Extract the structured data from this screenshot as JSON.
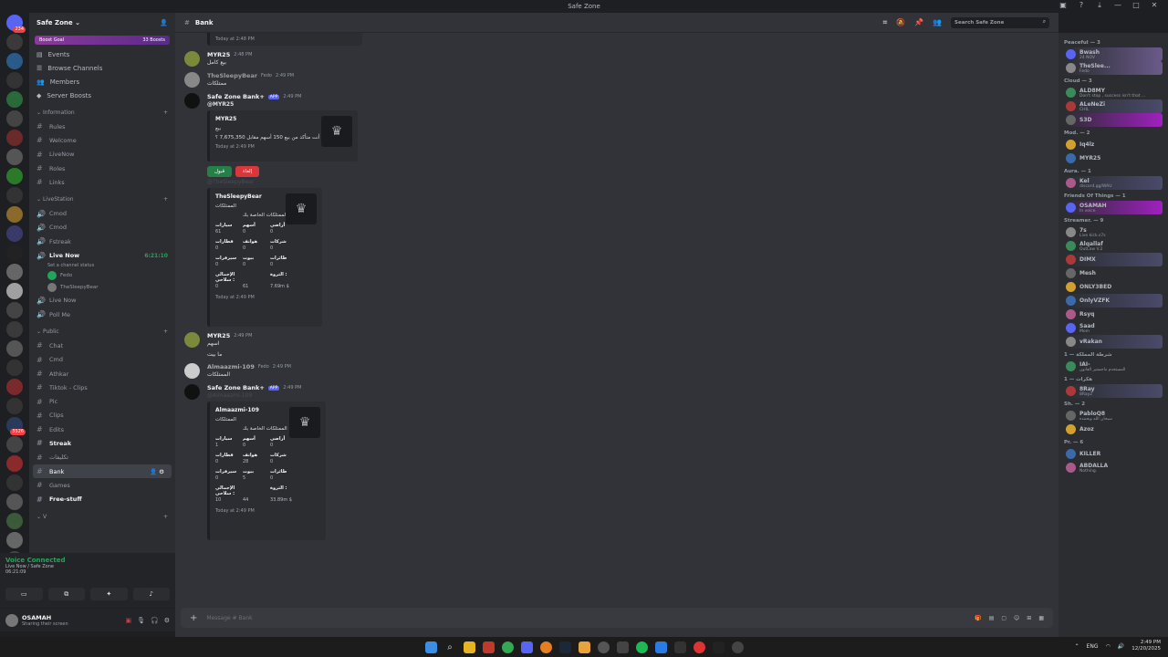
{
  "window": {
    "title": "Safe Zone"
  },
  "servers": {
    "badges": [
      "234",
      "",
      "",
      "",
      "",
      "",
      "",
      "",
      "",
      "",
      "",
      "",
      "",
      "",
      "",
      "",
      "",
      "",
      "",
      "",
      "",
      "3526",
      "",
      "",
      "",
      "",
      "",
      "",
      "",
      ""
    ]
  },
  "guild": {
    "name": "Safe Zone",
    "boost_label": "Boost Goal",
    "boost_count": "33 Boosts",
    "nav": [
      "Events",
      "Browse Channels",
      "Members",
      "Server Boosts"
    ],
    "categories": {
      "information": "Information",
      "livestation": "LiveStation",
      "public": "Public",
      "last": "V"
    },
    "info_channels": [
      "Rules",
      "Welcome",
      "LiveNow",
      "Roles",
      "Links"
    ],
    "live_channels": [
      "Cmod",
      "Cmod",
      "Fstreak"
    ],
    "live_now": {
      "name": "Live Now",
      "time": "6:21:10",
      "status": "Set a channel status"
    },
    "vc_users": [
      "Fedo",
      "TheSleepyBear"
    ],
    "more_live": [
      "Live Now",
      "Poll Me"
    ],
    "public_channels": [
      "Chat",
      "Cmd",
      "Athkar",
      "Tiktok - Clips",
      "Pic",
      "Clips",
      "Edits",
      "Streak",
      "تكليفات",
      "Bank",
      "Games",
      "Free-stuff"
    ]
  },
  "voice": {
    "title": "Voice Connected",
    "sub": "Live Now / Safe Zone",
    "time": "06:21:09"
  },
  "user": {
    "name": "OSAMAH",
    "status": "Sharing their screen"
  },
  "channel": {
    "name": "Bank",
    "search_placeholder": "Search Safe Zone",
    "composer_placeholder": "Message # Bank"
  },
  "messages": {
    "m0_time": "Today at 2:48 PM",
    "m1": {
      "author": "MYR25",
      "time": "2:48 PM",
      "text": "بيع كامل"
    },
    "m2": {
      "author": "TheSleepyBear",
      "tag": "Fedo",
      "time": "2:49 PM",
      "text": "ممتلكات"
    },
    "m3": {
      "author": "Safe Zone Bank+",
      "app": "APP",
      "time": "2:49 PM",
      "mention": "@MYR25",
      "embed_author": "MYR25",
      "embed_title": "بيع",
      "embed_text": "هل أنت متأكد من بيع 150 أسهم مقابل 7,675,350 ؟",
      "embed_time": "Today at 2:49 PM",
      "btn_accept": "قبول",
      "btn_cancel": "إلغاء"
    },
    "m4": {
      "mention": "@TheSleepyBear",
      "embed_author": "TheSleepyBear",
      "embed_title": "الممتلكات",
      "embed_sub": "الممتلكات الخاصة بك",
      "grid": [
        [
          "سيارات",
          "أسهم",
          "أراضي"
        ],
        [
          "61",
          "0",
          "0"
        ],
        [
          "قطارات",
          "هواتف",
          "شركات"
        ],
        [
          "0",
          "0",
          "0"
        ],
        [
          "سيرفرات",
          "بيوت",
          "طائرات"
        ],
        [
          "0",
          "0",
          "0"
        ],
        [
          "الإجمالي : سلاحي",
          "",
          "الثروة :"
        ],
        [
          "0",
          "61",
          "7.69m $"
        ]
      ],
      "embed_time": "Today at 2:49 PM"
    },
    "m5": {
      "author": "MYR25",
      "time": "2:49 PM",
      "text1": "اسهم",
      "text2": "ما بيت"
    },
    "m6": {
      "author": "Almaazmi-109",
      "tag": "Fedo",
      "time": "2:49 PM",
      "text": "الممتلكات"
    },
    "m7": {
      "author": "Safe Zone Bank+",
      "app": "APP",
      "time": "2:49 PM",
      "mention": "@Almaazmi-109",
      "embed_author": "Almaazmi-109",
      "embed_title": "الممتلكات",
      "embed_sub": "الممتلكات الخاصة بك",
      "grid": [
        [
          "سيارات",
          "أسهم",
          "أراضي"
        ],
        [
          "1",
          "0",
          "0"
        ],
        [
          "قطارات",
          "هواتف",
          "شركات"
        ],
        [
          "0",
          "28",
          "0"
        ],
        [
          "سيرفرات",
          "بيوت",
          "طائرات"
        ],
        [
          "0",
          "5",
          "0"
        ],
        [
          "الإجمالي : سلاحي",
          "",
          "الثروة :"
        ],
        [
          "10",
          "44",
          "33.89m $"
        ]
      ],
      "embed_time": "Today at 2:49 PM"
    }
  },
  "members": {
    "cat_peaceful": "Peaceful — 3",
    "peaceful": [
      {
        "name": "Bwash",
        "sub": "24 NOV"
      },
      {
        "name": "TheSlee...",
        "sub": "Fedo"
      }
    ],
    "cat_cloud": "Cloud — 3",
    "cloud": [
      {
        "name": "ALD8MY",
        "sub": "Don't stop , success isn't that ..."
      },
      {
        "name": "ALeNeZi",
        "sub": "CHIL"
      },
      {
        "name": "S3D",
        "sub": ""
      }
    ],
    "cat_mod": "Mod. — 2",
    "mod": [
      {
        "name": "Iq4lz",
        "sub": ""
      },
      {
        "name": "MYR25",
        "sub": ""
      }
    ],
    "cat_aura": "Aura. — 1",
    "aura": [
      {
        "name": "Kel",
        "sub": "discord.gg/WAU"
      }
    ],
    "cat_friends": "Friends Of Things — 1",
    "friends": [
      {
        "name": "OSAMAH",
        "sub": "In voice"
      }
    ],
    "cat_streamer": "Streamer. — 9",
    "streamer": [
      {
        "name": "7s",
        "sub": "Live kick.s7s"
      },
      {
        "name": "Alqallaf",
        "sub": "OutLaw V.2"
      },
      {
        "name": "DIMX",
        "sub": ""
      },
      {
        "name": "Mesh",
        "sub": ""
      },
      {
        "name": "ONLY3BED",
        "sub": ""
      },
      {
        "name": "OnlyVZFK",
        "sub": ""
      },
      {
        "name": "Rsyq",
        "sub": ""
      },
      {
        "name": "Saad",
        "sub": "Mom"
      },
      {
        "name": "vRakan",
        "sub": ""
      }
    ],
    "cat_police": "شرطة المملكة — 1",
    "police": [
      {
        "name": "IAI-",
        "sub": "المستخدم ماجستير القانون"
      }
    ],
    "cat_h": "هكرات — 1",
    "h": [
      {
        "name": "8Ray",
        "sub": "8Ray2"
      }
    ],
    "cat_sh": "Sh. — 2",
    "sh": [
      {
        "name": "PabloQ8",
        "sub": "سبحان الله وبحمده"
      },
      {
        "name": "Azoz",
        "sub": ""
      }
    ],
    "cat_pr": "Pr. — 6",
    "pr": [
      {
        "name": "KILLER",
        "sub": ""
      },
      {
        "name": "ABDALLA",
        "sub": "Nothing."
      }
    ]
  },
  "taskbar": {
    "lang": "ENG",
    "time": "2:49 PM",
    "date": "12/20/2025"
  }
}
